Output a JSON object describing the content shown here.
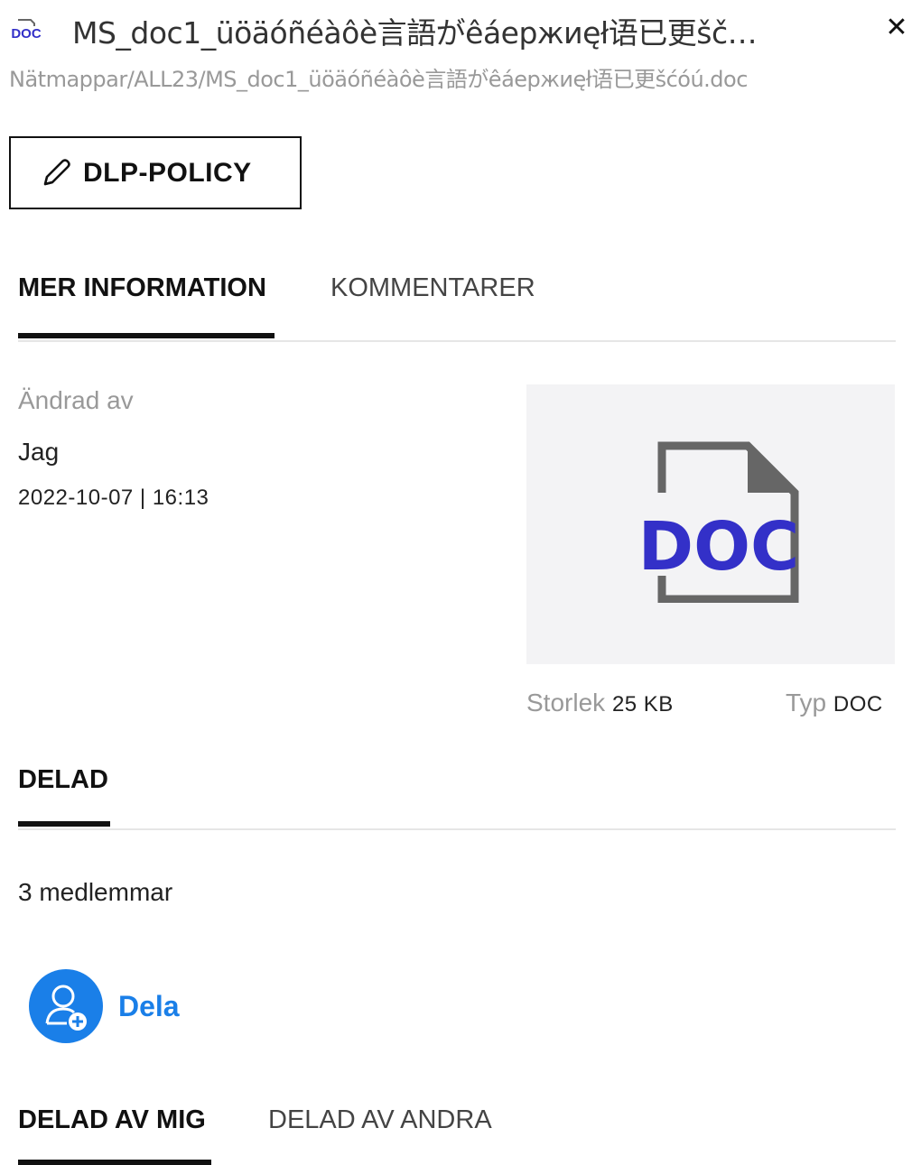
{
  "header": {
    "file_icon": "doc-file-icon",
    "title": "MS_doc1_üöäóñéàôè言語がêáержиęł语已更šč…",
    "breadcrumb": "Nätmappar/ALL23/MS_doc1_üöäóñéàôè言語がêáержиęł语已更šćóú.doc",
    "close_icon": "close-icon"
  },
  "policy_button": {
    "label": "DLP-POLICY",
    "icon": "pencil-icon"
  },
  "details_tabs": [
    {
      "label": "MER INFORMATION",
      "active": true
    },
    {
      "label": "KOMMENTARER",
      "active": false
    }
  ],
  "modified": {
    "label": "Ändrad av",
    "by": "Jag",
    "datetime": "2022-10-07 | 16:13"
  },
  "preview": {
    "badge": "DOC",
    "badge_color": "#3330c8",
    "outline_color": "#666666"
  },
  "meta": {
    "size_label": "Storlek",
    "size_value": "25 KB",
    "type_label": "Typ",
    "type_value": "DOC"
  },
  "shared_section": {
    "label": "DELAD"
  },
  "members_count": "3 medlemmar",
  "share_button": {
    "label": "Dela",
    "icon": "add-user-icon",
    "color": "#1a7fe8"
  },
  "shared_tabs": [
    {
      "label": "DELAD AV MIG",
      "active": true
    },
    {
      "label": "DELAD AV ANDRA",
      "active": false
    }
  ]
}
